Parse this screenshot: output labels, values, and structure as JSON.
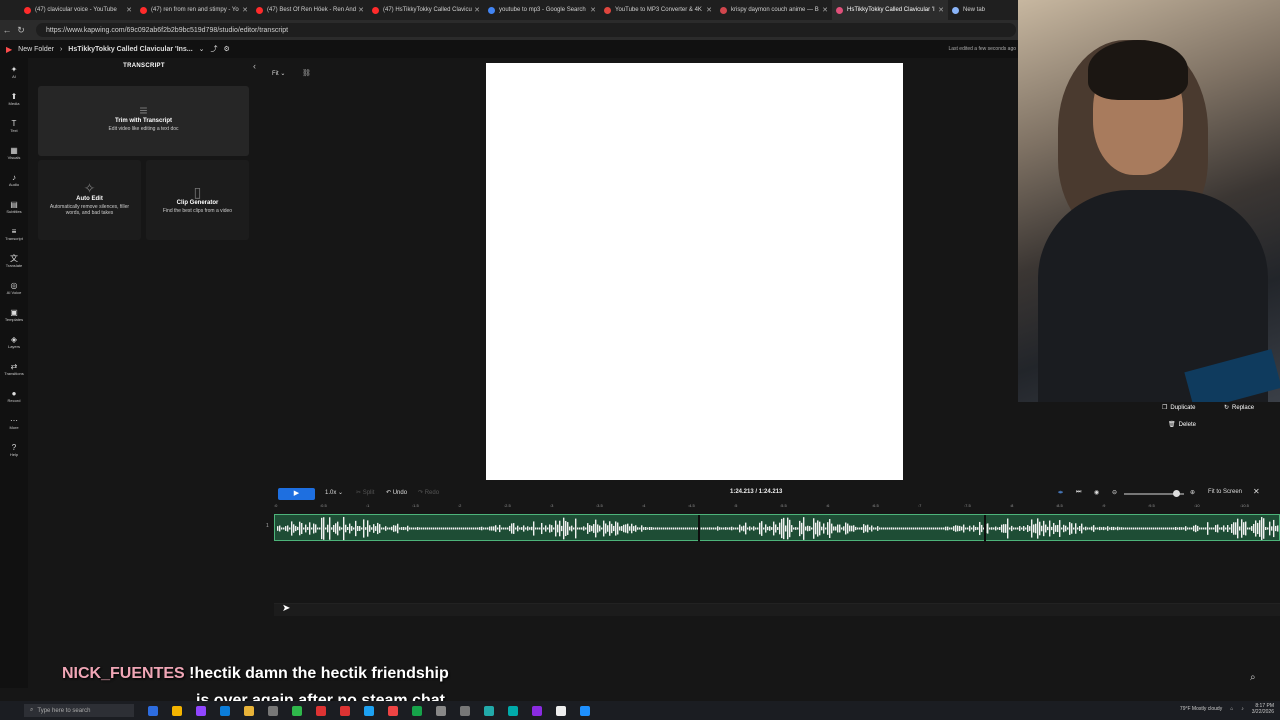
{
  "browser": {
    "tabs": [
      {
        "label": "(47) clavicular voice - YouTube",
        "color": "#ff2b2b",
        "active": false
      },
      {
        "label": "(47) ren from ren and stimpy - Yo",
        "color": "#ff2b2b",
        "active": false
      },
      {
        "label": "(47) Best Of Ren Höek - Ren And",
        "color": "#ff2b2b",
        "active": false
      },
      {
        "label": "(47) HsTikkyTokky Called Clavicu",
        "color": "#ff2b2b",
        "active": false
      },
      {
        "label": "youtube to mp3 - Google Search",
        "color": "#4285f4",
        "active": false
      },
      {
        "label": "YouTube to MP3 Converter & 4K",
        "color": "#e0463e",
        "active": false
      },
      {
        "label": "krispy daymon couch anime — B",
        "color": "#d1464d",
        "active": false
      },
      {
        "label": "HsTikkyTokky Called Clavicular 'I",
        "color": "#e0507a",
        "active": true
      },
      {
        "label": "New tab",
        "color": "#8ab4f8",
        "active": false
      }
    ],
    "url": "https://www.kapwing.com/69c092ab6f2b2b9bc519d798/studio/editor/transcript"
  },
  "app": {
    "folder": "New Folder",
    "project_title": "HsTikkyTokky Called Clavicular 'Ins...",
    "last_edited": "Last edited a few seconds ago"
  },
  "rail": [
    {
      "icon": "✦",
      "label": "AI"
    },
    {
      "icon": "⬆",
      "label": "Media"
    },
    {
      "icon": "T",
      "label": "Text"
    },
    {
      "icon": "▦",
      "label": "Visuals"
    },
    {
      "icon": "♪",
      "label": "Audio"
    },
    {
      "icon": "▤",
      "label": "Subtitles"
    },
    {
      "icon": "≡",
      "label": "Transcript"
    },
    {
      "icon": "文",
      "label": "Translate"
    },
    {
      "icon": "◎",
      "label": "AI Voice"
    },
    {
      "icon": "▣",
      "label": "Templates"
    },
    {
      "icon": "◈",
      "label": "Layers"
    },
    {
      "icon": "⇄",
      "label": "Transitions"
    },
    {
      "icon": "●",
      "label": "Record"
    },
    {
      "icon": "⋯",
      "label": "More"
    },
    {
      "icon": "?",
      "label": "Help"
    }
  ],
  "panel": {
    "title": "TRANSCRIPT",
    "trim": {
      "title": "Trim with Transcript",
      "desc": "Edit video like editing a text doc"
    },
    "auto_edit": {
      "title": "Auto Edit",
      "desc": "Automatically remove silences, filler words, and bad takes"
    },
    "clip_gen": {
      "title": "Clip Generator",
      "desc": "Find the best clips from a video"
    }
  },
  "canvas": {
    "fit_label": "Fit ⌄"
  },
  "side_actions": {
    "duplicate": "Duplicate",
    "replace": "Replace",
    "delete": "Delete"
  },
  "timeline": {
    "speed": "1.0x ⌄",
    "split": "✂ Split",
    "undo": "↶ Undo",
    "redo": "↷ Redo",
    "timecode": "1:24.213 / 1:24.213",
    "fit_screen": "Fit to Screen",
    "zoom_level": 0.88,
    "track_number": "1",
    "ruler_ticks": [
      ":0",
      ":0.5",
      ":1",
      ":1.5",
      ":2",
      ":2.5",
      ":3",
      ":3.5",
      ":4",
      ":4.5",
      ":5",
      ":5.5",
      ":6",
      ":6.5",
      ":7",
      ":7.5",
      ":8",
      ":8.5",
      ":9",
      ":9.5",
      ":10",
      ":10.5"
    ],
    "segment_splits": [
      0.42,
      0.705
    ]
  },
  "chat": {
    "user": "NICK_FUENTES",
    "line1": "!hectik damn the hectik friendship",
    "line2": "is over again after no steam chat"
  },
  "taskbar": {
    "search_placeholder": "Type here to search",
    "weather": "79°F Mostly cloudy",
    "time": "8:17 PM",
    "date": "3/22/2026"
  }
}
